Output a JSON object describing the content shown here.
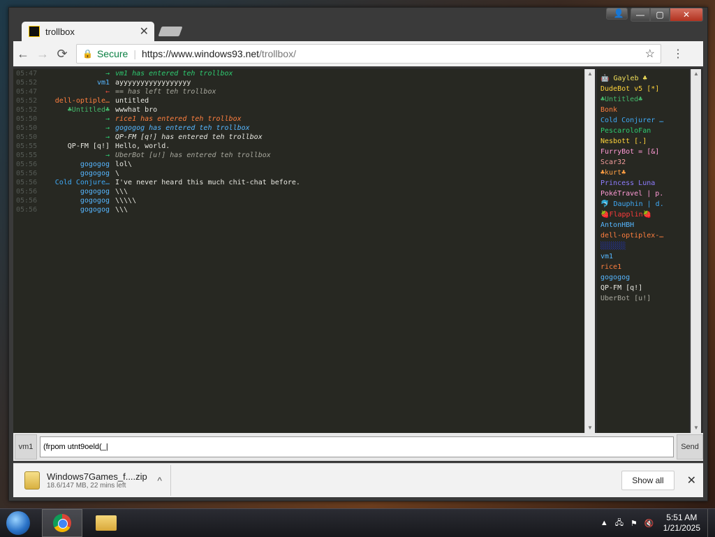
{
  "browser": {
    "tab_title": "trollbox",
    "tab_close": "✕",
    "secure_label": "Secure",
    "url_scheme": "https://",
    "url_host": "www.windows93.net",
    "url_path": "/trollbox/",
    "nav_back": "←",
    "nav_forward": "→",
    "nav_reload": "⟳",
    "star": "☆",
    "menu": "⋮"
  },
  "window_controls": {
    "user": "👤",
    "min": "—",
    "max": "▢",
    "close": "✕"
  },
  "chat": {
    "messages": [
      {
        "time": "05:47",
        "nick": "→",
        "nick_color": "#2ecc71",
        "text": "vm1 has entered teh trollbox",
        "text_color": "#2ecc71",
        "sys_suffix": ""
      },
      {
        "time": "05:52",
        "nick": "vm1",
        "nick_color": "#56b6ff",
        "text": "ayyyyyyyyyyyyyyyyy",
        "text_color": "#e8e8e2"
      },
      {
        "time": "05:47",
        "nick": "←",
        "nick_color": "#e74c3c",
        "text": "== has left teh trollbox",
        "text_color": "#a8a89e"
      },
      {
        "time": "05:52",
        "nick": "dell-optiple…",
        "nick_color": "#ff7f3f",
        "text": "untitled",
        "text_color": "#e8e8e2"
      },
      {
        "time": "05:52",
        "nick": "♣Untitled♣",
        "nick_color": "#45b86b",
        "text": "wwwhat   bro",
        "text_color": "#e8e8e2"
      },
      {
        "time": "05:50",
        "nick": "→",
        "nick_color": "#2ecc71",
        "text": "rice1 has entered teh trollbox",
        "text_color": "#ff7f3f"
      },
      {
        "time": "05:50",
        "nick": "→",
        "nick_color": "#2ecc71",
        "text": "gogogog has entered teh trollbox",
        "text_color": "#56b6ff"
      },
      {
        "time": "05:50",
        "nick": "→",
        "nick_color": "#2ecc71",
        "text": "QP-FM [q!] has entered teh trollbox",
        "text_color": "#e8e8e2"
      },
      {
        "time": "05:55",
        "nick": "QP-FM [q!]",
        "nick_color": "#e8e8e2",
        "text": "Hello, world.",
        "text_color": "#e8e8e2"
      },
      {
        "time": "05:55",
        "nick": "→",
        "nick_color": "#2ecc71",
        "text": "UberBot [u!] has entered teh trollbox",
        "text_color": "#a8a89e"
      },
      {
        "time": "05:56",
        "nick": "gogogog",
        "nick_color": "#56b6ff",
        "text": "lol\\",
        "text_color": "#e8e8e2"
      },
      {
        "time": "05:56",
        "nick": "gogogog",
        "nick_color": "#56b6ff",
        "text": "\\",
        "text_color": "#e8e8e2"
      },
      {
        "time": "05:56",
        "nick": "Cold Conjure…",
        "nick_color": "#3fa9f5",
        "text": "I've never heard this much chit-chat before.",
        "text_color": "#e8e8e2"
      },
      {
        "time": "05:56",
        "nick": "gogogog",
        "nick_color": "#56b6ff",
        "text": "\\\\\\",
        "text_color": "#e8e8e2"
      },
      {
        "time": "05:56",
        "nick": "gogogog",
        "nick_color": "#56b6ff",
        "text": "\\\\\\\\\\",
        "text_color": "#e8e8e2"
      },
      {
        "time": "05:56",
        "nick": "gogogog",
        "nick_color": "#56b6ff",
        "text": "\\\\\\",
        "text_color": "#e8e8e2"
      }
    ]
  },
  "users": [
    {
      "name": "🤖 Gayleb ♣",
      "color": "#f1e05a"
    },
    {
      "name": "DudeBot v5 [*]",
      "color": "#ffd43b"
    },
    {
      "name": "♣Untitled♣",
      "color": "#45b86b"
    },
    {
      "name": "Bonk",
      "color": "#ff7f3f"
    },
    {
      "name": "Cold Conjurer …",
      "color": "#3fa9f5"
    },
    {
      "name": "PescaroloFan",
      "color": "#2ecc71"
    },
    {
      "name": "Nesbott [.]",
      "color": "#ffd43b"
    },
    {
      "name": "FurryBot = [&]",
      "color": "#ff9ad5"
    },
    {
      "name": "Scar32",
      "color": "#f39c9c"
    },
    {
      "name": "♣kurt♣",
      "color": "#ff9f43"
    },
    {
      "name": "Princess Luna",
      "color": "#8e7cff"
    },
    {
      "name": "PokéTravel | p.",
      "color": "#ff9ad5"
    },
    {
      "name": "🐬 Dauphin | d.",
      "color": "#3fa9f5"
    },
    {
      "name": "🍓Flapplin🍓",
      "color": "#ff3b3b"
    },
    {
      "name": "AntonHBH",
      "color": "#56b6ff"
    },
    {
      "name": "dell-optiplex-…",
      "color": "#ff7f3f"
    },
    {
      "name": "░░░░░░",
      "color": "#1e3cff"
    },
    {
      "name": "vm1",
      "color": "#56b6ff"
    },
    {
      "name": "rice1",
      "color": "#ff7f3f"
    },
    {
      "name": "gogogog",
      "color": "#56b6ff"
    },
    {
      "name": "QP-FM [q!]",
      "color": "#e8e8e2"
    },
    {
      "name": "UberBot [u!]",
      "color": "#a8a89e"
    }
  ],
  "input": {
    "nick": "vm1",
    "value": "(frpom utnt9oeld(_|",
    "send": "Send"
  },
  "download": {
    "filename": "Windows7Games_f....zip",
    "progress": "18.6/147 MB, 22 mins left",
    "show_all": "Show all",
    "close": "✕",
    "chevron": "^"
  },
  "taskbar": {
    "time": "5:51 AM",
    "date": "1/21/2025",
    "tray_arrow": "▲"
  }
}
